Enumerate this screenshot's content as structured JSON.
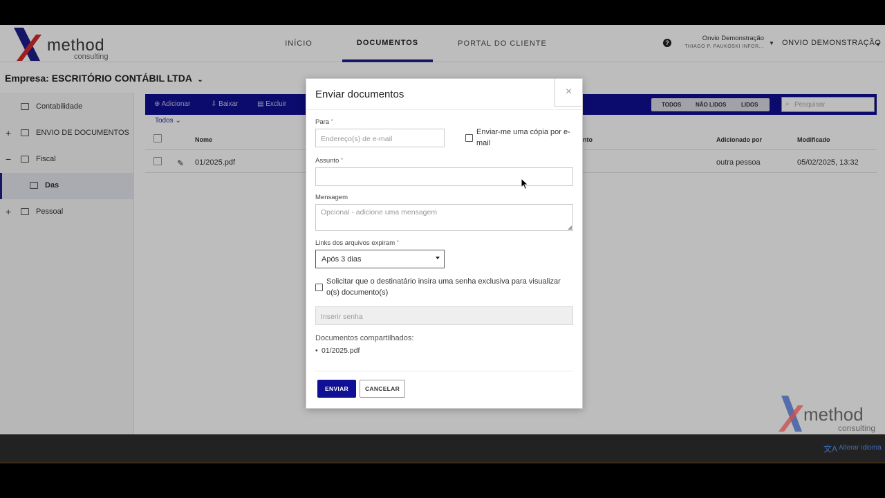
{
  "brand": {
    "name": "method",
    "sub": "consulting",
    "x_color": "#1e1e8c",
    "accent": "#d52b2b"
  },
  "nav": {
    "tabs": [
      {
        "label": "INÍCIO"
      },
      {
        "label": "DOCUMENTOS"
      },
      {
        "label": "PORTAL DO CLIENTE"
      }
    ],
    "active": "DOCUMENTOS"
  },
  "user": {
    "name": "Onvio Demonstração",
    "sub": "THIAGO P. PAUKOSKI INFOR...",
    "account": "ONVIO DEMONSTRAÇÃO"
  },
  "company": {
    "label": "Empresa: ESCRITÓRIO CONTÁBIL LTDA"
  },
  "sidebar": {
    "items": [
      {
        "label": "Contabilidade",
        "toggle": ""
      },
      {
        "label": "ENVIO DE DOCUMENTOS",
        "toggle": "+"
      },
      {
        "label": "Fiscal",
        "toggle": "−"
      },
      {
        "label": "Das",
        "toggle": ""
      },
      {
        "label": "Pessoal",
        "toggle": "+"
      }
    ]
  },
  "toolbar": {
    "add": "Adicionar",
    "download": "Baixar",
    "delete": "Excluir",
    "filters": [
      "TODOS",
      "NÃO LIDOS",
      "LIDOS"
    ],
    "search_placeholder": "Pesquisar"
  },
  "filter_label": "Todos",
  "table": {
    "headers": {
      "name": "Nome",
      "partial": "nto",
      "added_by": "Adicionado por",
      "modified": "Modificado"
    },
    "rows": [
      {
        "name": "01/2025.pdf",
        "added_by": "outra pessoa",
        "modified": "05/02/2025, 13:32"
      }
    ]
  },
  "dialog": {
    "title": "Enviar documentos",
    "close": "×",
    "to_label": "Para",
    "to_placeholder": "Endereço(s) de e-mail",
    "copy_label": "Enviar-me uma cópia por e-mail",
    "subject_label": "Assunto",
    "message_label": "Mensagem",
    "message_placeholder": "Opcional - adicione uma mensagem",
    "expire_label": "Links dos arquivos expiram",
    "expire_value": "Após 3 dias",
    "password_request": "Solicitar que o destinatário insira uma senha exclusiva para visualizar o(s) documento(s)",
    "password_placeholder": "Inserir senha",
    "shared_title": "Documentos compartilhados:",
    "shared_items": [
      "01/2025.pdf"
    ],
    "send": "ENVIAR",
    "cancel": "CANCELAR",
    "required_mark": "*"
  },
  "footer": {
    "language": "Alterar idioma"
  }
}
